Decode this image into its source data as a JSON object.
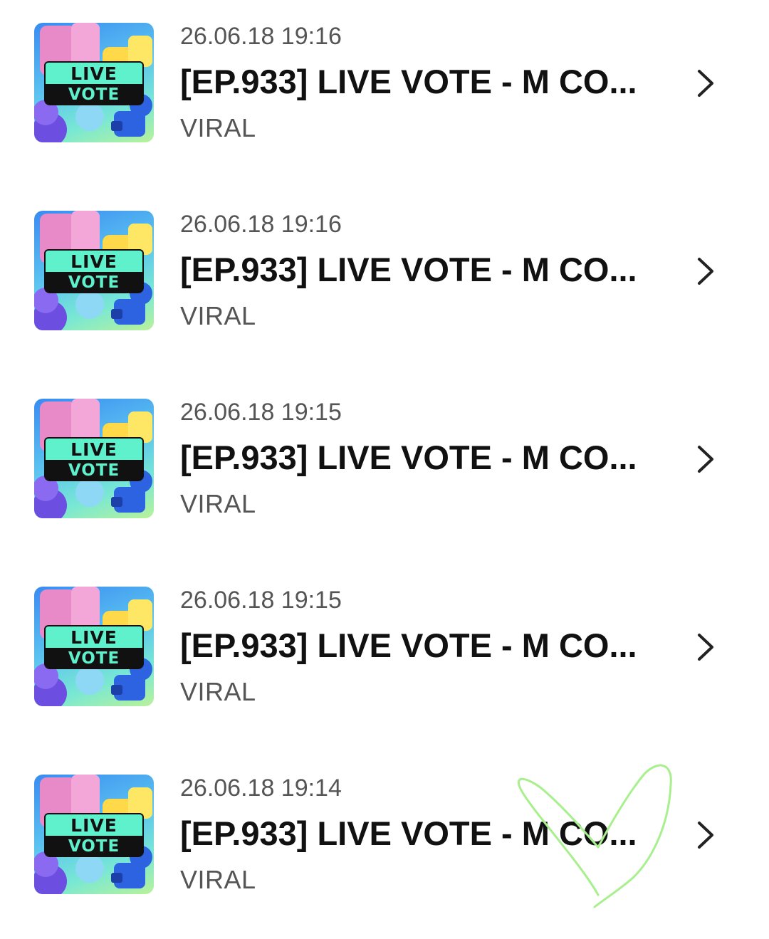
{
  "items": [
    {
      "date": "26.06.18 19:16",
      "title": "[EP.933] LIVE VOTE - M CO...",
      "subtitle": "VIRAL",
      "thumb_text": [
        "LIVE",
        "VOTE"
      ]
    },
    {
      "date": "26.06.18 19:16",
      "title": "[EP.933] LIVE VOTE - M CO...",
      "subtitle": "VIRAL",
      "thumb_text": [
        "LIVE",
        "VOTE"
      ]
    },
    {
      "date": "26.06.18 19:15",
      "title": "[EP.933] LIVE VOTE - M CO...",
      "subtitle": "VIRAL",
      "thumb_text": [
        "LIVE",
        "VOTE"
      ]
    },
    {
      "date": "26.06.18 19:15",
      "title": "[EP.933] LIVE VOTE - M CO...",
      "subtitle": "VIRAL",
      "thumb_text": [
        "LIVE",
        "VOTE"
      ]
    },
    {
      "date": "26.06.18 19:14",
      "title": "[EP.933] LIVE VOTE - M CO...",
      "subtitle": "VIRAL",
      "thumb_text": [
        "LIVE",
        "VOTE"
      ]
    }
  ],
  "icons": {
    "row_arrow": "chevron-right-icon",
    "annotation": "hand-drawn-heart"
  },
  "colors": {
    "title": "#111111",
    "meta": "#555555",
    "heart_stroke": "#a8ef8e",
    "thumb_accent": "#5ff0cc"
  }
}
